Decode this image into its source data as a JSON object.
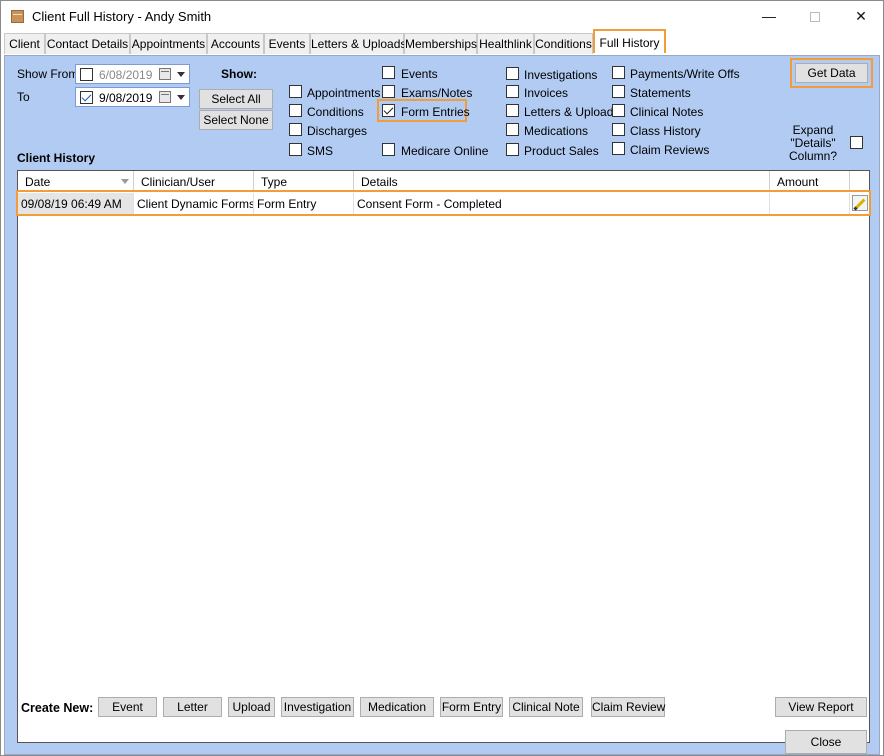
{
  "window": {
    "title": "Client Full History - Andy Smith",
    "minimize_glyph": "—",
    "close_glyph": "✕",
    "app_icon": "folder-icon"
  },
  "tabs": [
    {
      "label": "Client"
    },
    {
      "label": "Contact Details"
    },
    {
      "label": "Appointments"
    },
    {
      "label": "Accounts"
    },
    {
      "label": "Events"
    },
    {
      "label": "Letters & Uploads"
    },
    {
      "label": "Memberships"
    },
    {
      "label": "Healthlink"
    },
    {
      "label": "Conditions"
    },
    {
      "label": "Full History"
    }
  ],
  "active_tab": "Full History",
  "filters": {
    "show_from_label": "Show From",
    "to_label": "To",
    "from_date": "6/08/2019",
    "from_checked": false,
    "to_date": "9/08/2019",
    "to_checked": true,
    "show_label": "Show:",
    "select_all": "Select All",
    "select_none": "Select None",
    "get_data": "Get Data",
    "expand_label": "Expand \"Details\" Column?",
    "expand_checked": false
  },
  "checkboxes": [
    {
      "label": "Appointments",
      "checked": false
    },
    {
      "label": "Conditions",
      "checked": false
    },
    {
      "label": "Discharges",
      "checked": false
    },
    {
      "label": "SMS",
      "checked": false
    },
    {
      "label": "Events",
      "checked": false
    },
    {
      "label": "Exams/Notes",
      "checked": false
    },
    {
      "label": "Form Entries",
      "checked": true
    },
    {
      "label": "Medicare Online",
      "checked": false
    },
    {
      "label": "Investigations",
      "checked": false
    },
    {
      "label": "Invoices",
      "checked": false
    },
    {
      "label": "Letters & Uploads",
      "checked": false
    },
    {
      "label": "Medications",
      "checked": false
    },
    {
      "label": "Product Sales",
      "checked": false
    },
    {
      "label": "Payments/Write Offs",
      "checked": false
    },
    {
      "label": "Statements",
      "checked": false
    },
    {
      "label": "Clinical Notes",
      "checked": false
    },
    {
      "label": "Class History",
      "checked": false
    },
    {
      "label": "Claim Reviews",
      "checked": false
    }
  ],
  "history": {
    "section_label": "Client History",
    "columns": [
      "Date",
      "Clinician/User",
      "Type",
      "Details",
      "Amount"
    ],
    "rows": [
      {
        "date": "09/08/19 06:49 AM",
        "clinician": "Client Dynamic Forms...",
        "type": "Form Entry",
        "details": "Consent Form - Completed",
        "amount": ""
      }
    ]
  },
  "footer": {
    "create_new_label": "Create New:",
    "buttons": [
      "Event",
      "Letter",
      "Upload",
      "Investigation",
      "Medication",
      "Form Entry",
      "Clinical Note",
      "Claim Review"
    ],
    "view_report": "View Report",
    "close": "Close"
  }
}
